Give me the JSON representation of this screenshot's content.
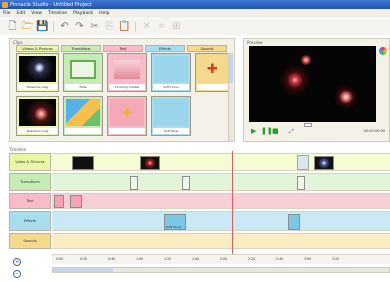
{
  "window": {
    "title": "Pinnacle Studio - Untitled Project"
  },
  "menu": [
    "File",
    "Edit",
    "View",
    "Timeline",
    "Playback",
    "Help"
  ],
  "toolbar": {
    "new": "new-icon",
    "open": "open-icon",
    "save": "save-icon",
    "undo": "undo-icon",
    "redo": "redo-icon",
    "cut": "cut-icon",
    "copy": "copy-icon",
    "paste": "paste-icon",
    "delete": "delete-icon",
    "extra": "extra-icon"
  },
  "assets": {
    "header": "Clips",
    "categories": [
      "Videos & Pictures",
      "Transitions",
      "Text",
      "Effects",
      "Sounds"
    ],
    "tiles": [
      {
        "caption": "Fireworks.mpg"
      },
      {
        "caption": "Fade"
      },
      {
        "caption": "Scrolling Credits"
      },
      {
        "caption": "Soft Focus"
      },
      {
        "caption": ""
      },
      {
        "caption": "Sparklers.mpg"
      },
      {
        "caption": ""
      },
      {
        "caption": ""
      },
      {
        "caption": "Soft Glow"
      }
    ]
  },
  "preview": {
    "header": "Preview",
    "time": "00:00:00:00"
  },
  "timeline": {
    "header": "Timeline",
    "tracks": [
      "Video & Pictures",
      "Transitions",
      "Text",
      "Effects",
      "Sounds"
    ],
    "clip_labels": {
      "effects1": "Soft Focus"
    },
    "ticks": [
      "0:00",
      "0:20",
      "0:40",
      "1:00",
      "1:20",
      "1:40",
      "2:00",
      "2:20",
      "2:40",
      "3:00",
      "3:20"
    ]
  }
}
